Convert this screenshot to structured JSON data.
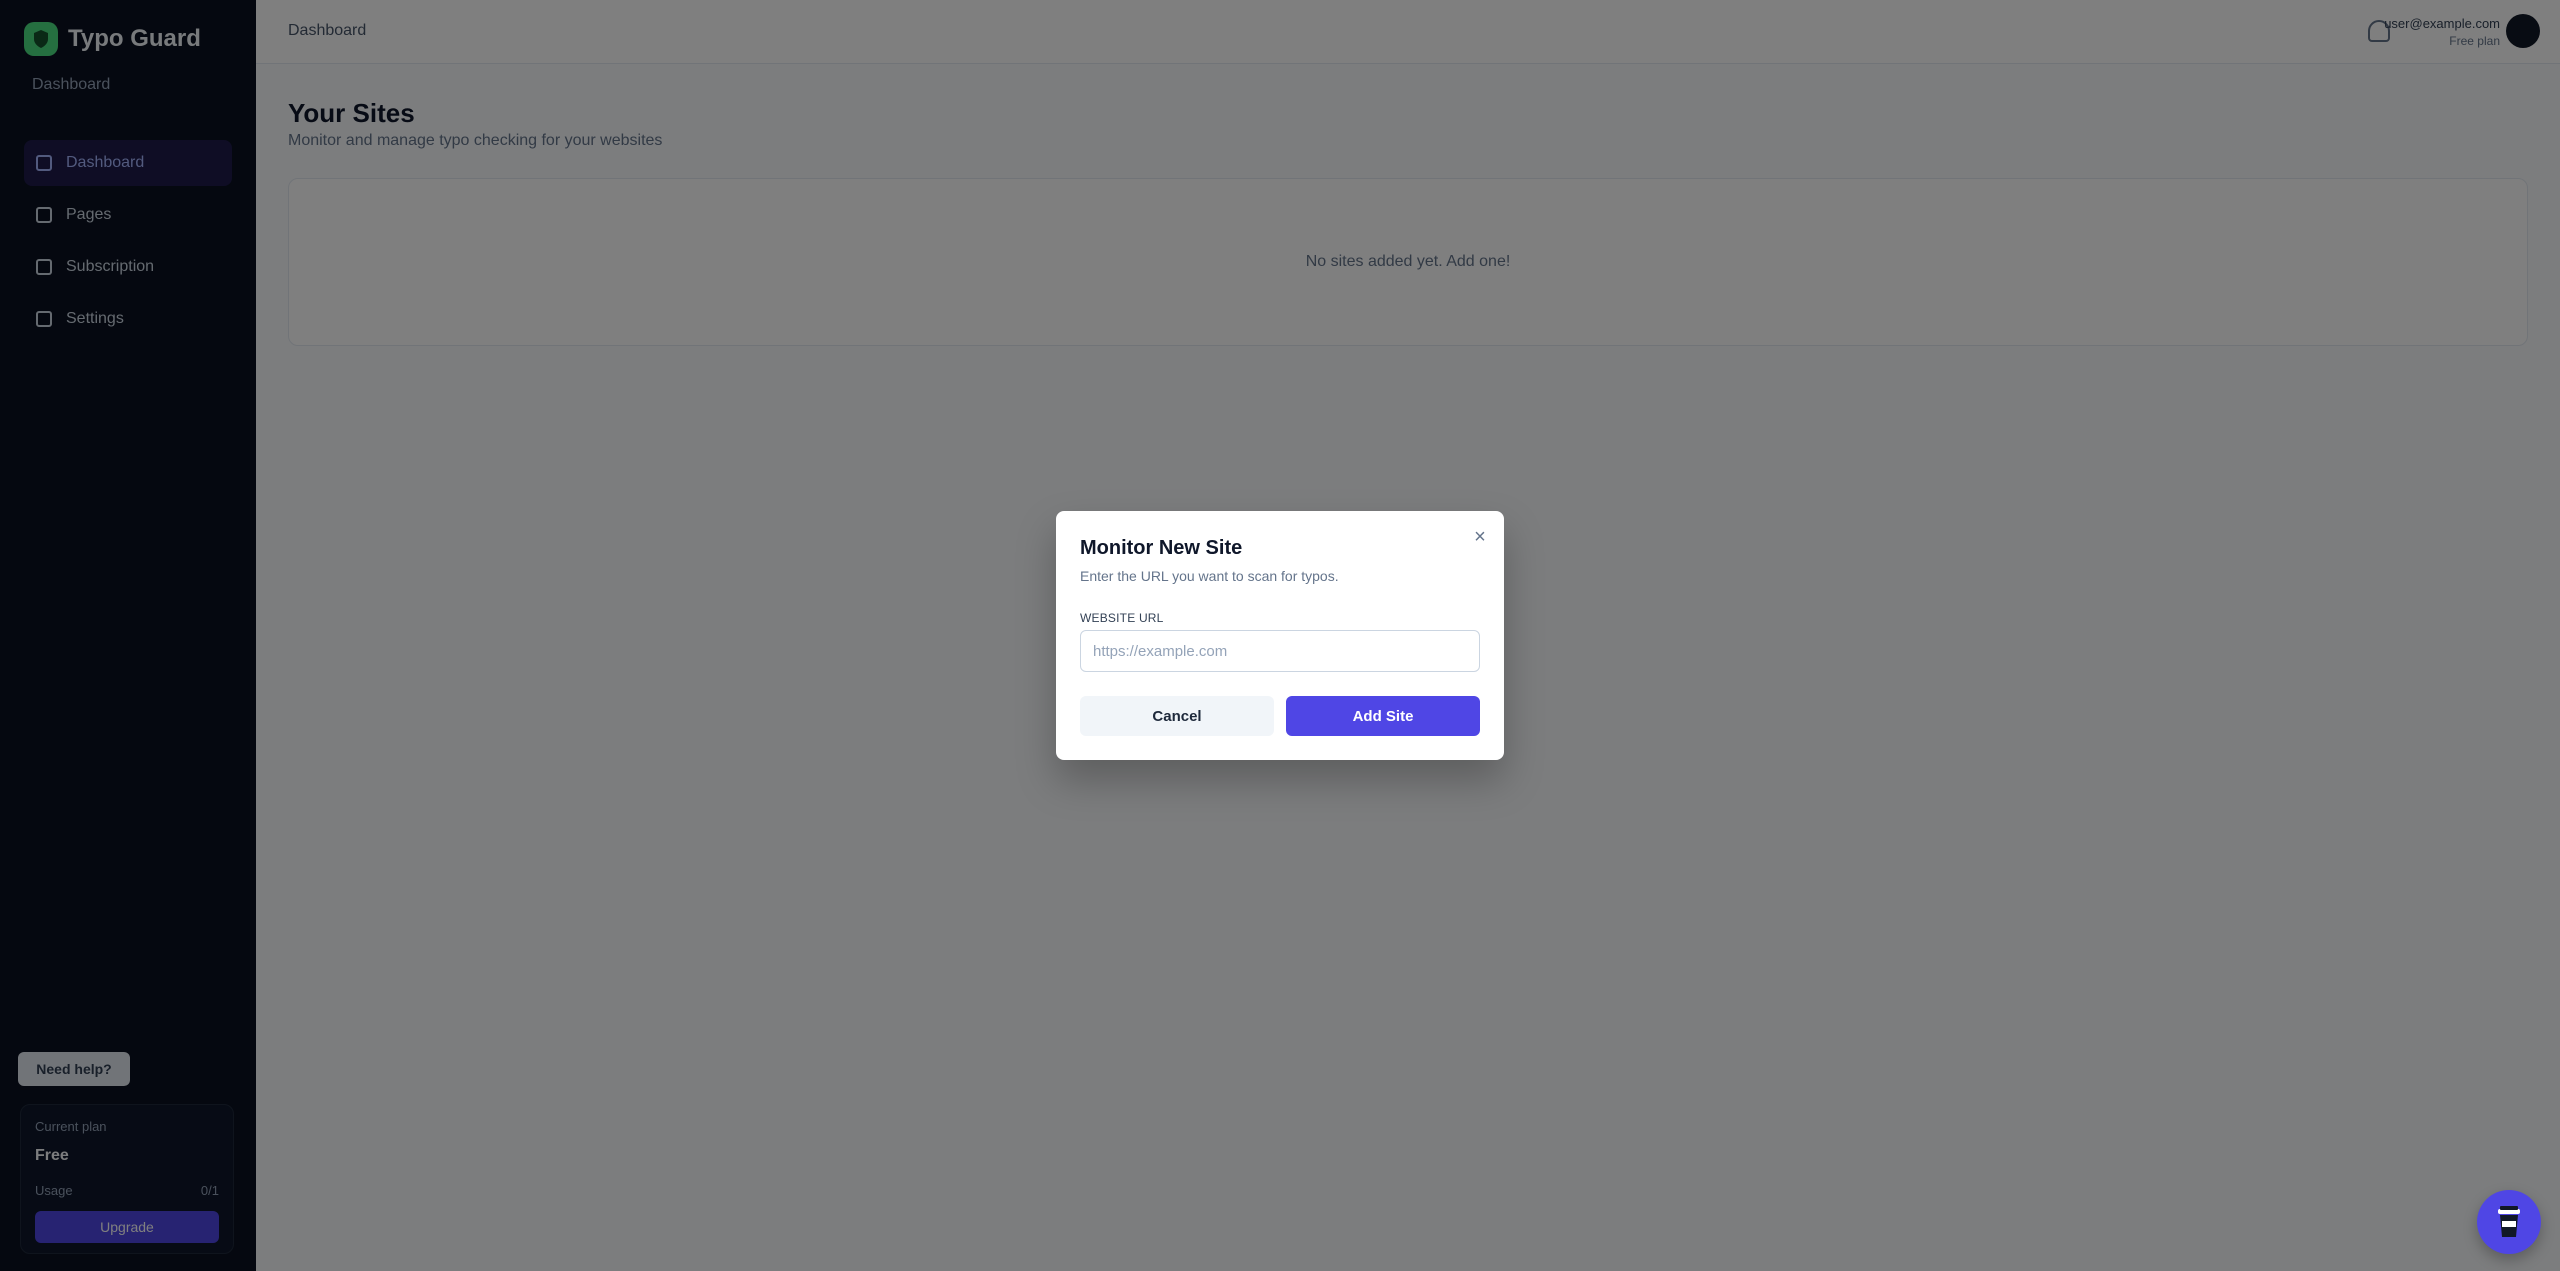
{
  "sidebar": {
    "brand_name": "Typo Guard",
    "brand_sub": "Dashboard",
    "items": [
      {
        "label": "Dashboard",
        "icon": "grid-icon"
      },
      {
        "label": "Pages",
        "icon": "file-icon"
      },
      {
        "label": "Subscription",
        "icon": "card-icon"
      },
      {
        "label": "Settings",
        "icon": "gear-icon"
      }
    ],
    "badge": "Need help?",
    "plan": {
      "label": "Current plan",
      "value": "Free",
      "usage_label": "Usage",
      "usage_count": "0/1",
      "upgrade": "Upgrade"
    }
  },
  "topbar": {
    "breadcrumb": "Dashboard",
    "user_email": "user@example.com",
    "user_plan": "Free plan"
  },
  "main": {
    "title": "Your Sites",
    "subtitle": "Monitor and manage typo checking for your websites",
    "empty_text": "No sites added yet. Add one!"
  },
  "modal": {
    "title": "Monitor New Site",
    "description": "Enter the URL you want to scan for typos.",
    "field_label": "WEBSITE URL",
    "url_placeholder": "https://example.com",
    "url_value": "",
    "cancel_label": "Cancel",
    "submit_label": "Add Site",
    "close_glyph": "×"
  },
  "colors": {
    "accent": "#4f46e5",
    "sidebar_bg": "#0b1120",
    "overlay": "rgba(0,0,0,0.5)"
  },
  "fab": {
    "icon": "coffee-cup-icon"
  }
}
